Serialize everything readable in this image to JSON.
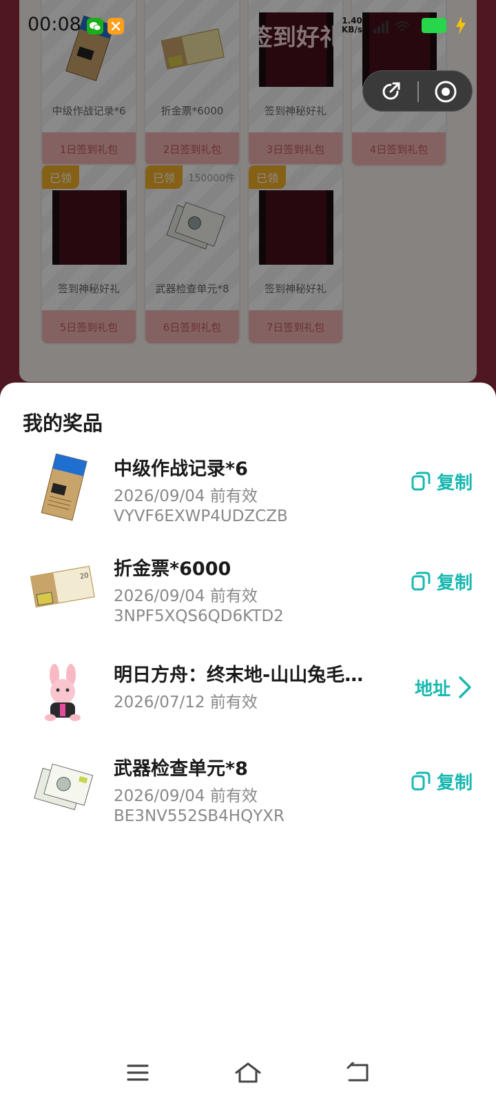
{
  "status_bar": {
    "time": "00:08",
    "net_speed_value": "1.40",
    "net_speed_unit": "KB/s",
    "colors": {
      "wechat": "#1aad19",
      "tool": "#ff9f1a",
      "battery": "#27d64a",
      "bolt": "#f4c20d"
    }
  },
  "background": {
    "gifts": [
      {
        "name": "中级作战记录*6",
        "day": "1日签到礼包",
        "thumb": "exp-record-icon"
      },
      {
        "name": "折金票*6000",
        "day": "2日签到礼包",
        "thumb": "gold-ticket-icon"
      },
      {
        "name": "签到神秘好礼",
        "day": "3日签到礼包",
        "thumb": "mystery-gift-icon",
        "sign": "签到好礼"
      },
      {
        "name": "",
        "day": "4日签到礼包",
        "thumb": "mystery-gift-icon",
        "sign": "签到好礼"
      },
      {
        "name": "签到神秘好礼",
        "day": "5日签到礼包",
        "claimed": "已领",
        "thumb": "mystery-gift-icon",
        "sign": "签到好礼"
      },
      {
        "name": "武器检查单元*8",
        "day": "6日签到礼包",
        "claimed": "已领",
        "stock": "150000件",
        "thumb": "weapon-unit-icon"
      },
      {
        "name": "签到神秘好礼",
        "day": "7日签到礼包",
        "claimed": "已领",
        "thumb": "mystery-gift-icon",
        "sign": "签到好礼"
      }
    ]
  },
  "sheet": {
    "title": "我的奖品",
    "prizes": [
      {
        "name": "中级作战记录*6",
        "expire": "2026/09/04 前有效",
        "code": "VYVF6EXWP4UDZCZB",
        "action": "复制",
        "icon": "exp-record-icon"
      },
      {
        "name": "折金票*6000",
        "expire": "2026/09/04 前有效",
        "code": "3NPF5XQS6QD6KTD2",
        "action": "复制",
        "icon": "gold-ticket-icon"
      },
      {
        "name": "明日方舟：终末地-山山兔毛…",
        "expire": "2026/07/12 前有效",
        "code": "",
        "action": "地址",
        "icon": "rabbit-plush-icon"
      },
      {
        "name": "武器检查单元*8",
        "expire": "2026/09/04 前有效",
        "code": "BE3NV552SB4HQYXR",
        "action": "复制",
        "icon": "weapon-unit-icon"
      }
    ],
    "accent_color": "#17b8b0"
  }
}
